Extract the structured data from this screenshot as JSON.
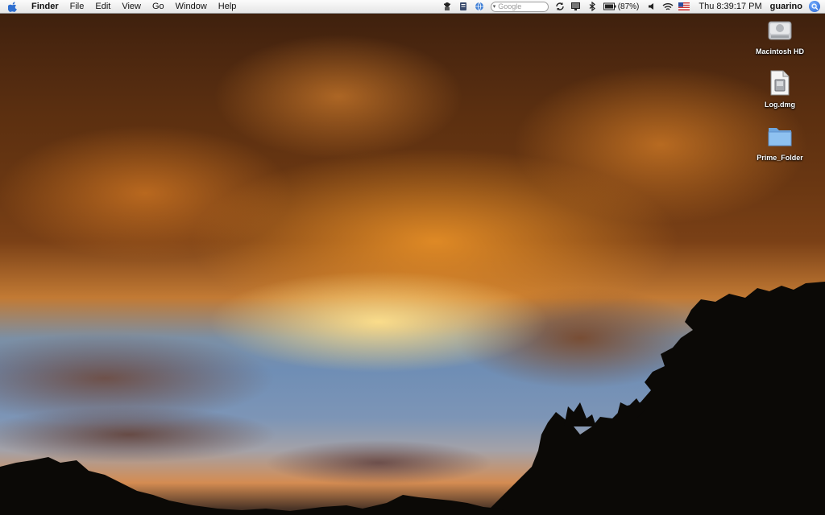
{
  "menubar": {
    "app_name": "Finder",
    "menus": [
      "File",
      "Edit",
      "View",
      "Go",
      "Window",
      "Help"
    ],
    "search_placeholder": "Google",
    "battery_percent": "(87%)",
    "clock": "Thu 8:39:17 PM",
    "user": "guarino"
  },
  "desktop": {
    "icons": [
      {
        "label": "Macintosh HD",
        "icon": "hard-drive-icon"
      },
      {
        "label": "Log.dmg",
        "icon": "disk-image-icon"
      },
      {
        "label": "Prime_Folder",
        "icon": "folder-icon"
      }
    ]
  },
  "colors": {
    "menubar": "#f0f0f0",
    "folder_blue": "#7fb4e6",
    "spotlight_blue": "#1f5fd2"
  }
}
